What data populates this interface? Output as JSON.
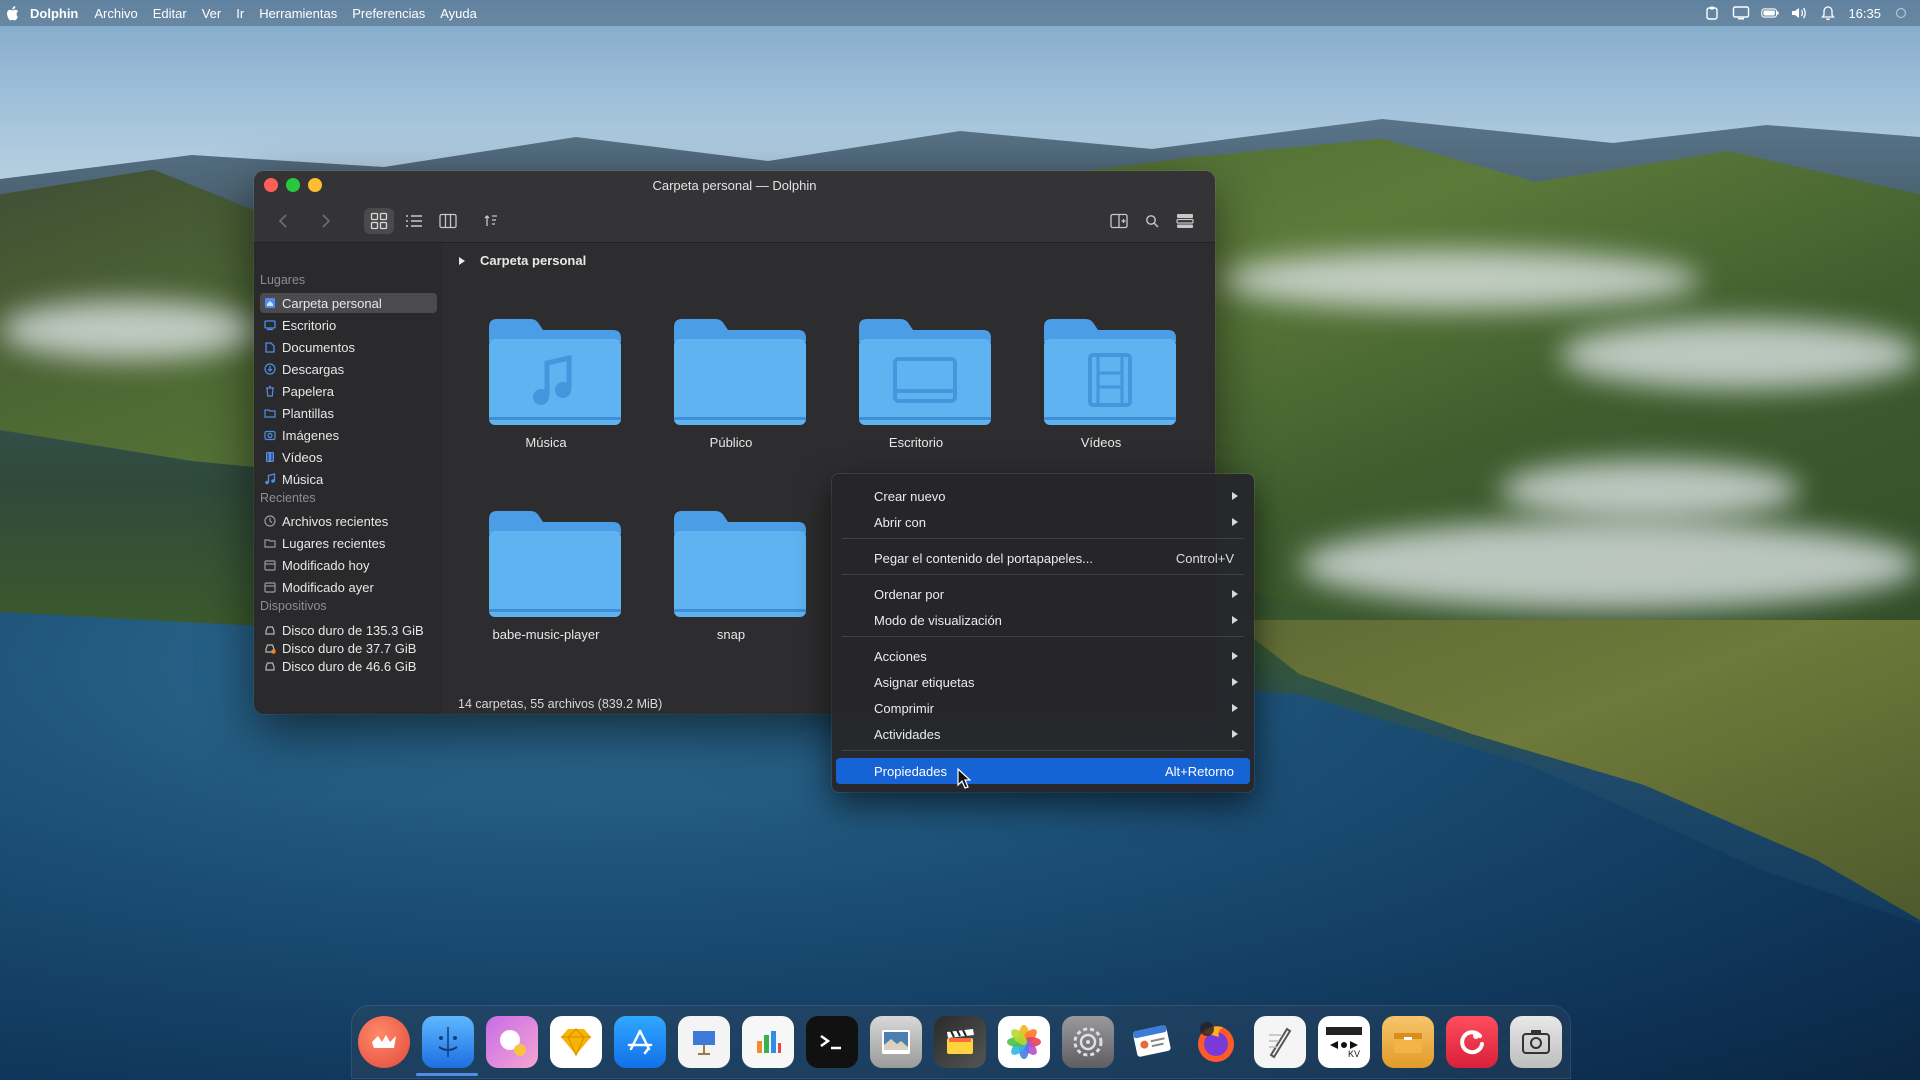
{
  "menubar": {
    "app_name": "Dolphin",
    "menus": [
      "Archivo",
      "Editar",
      "Ver",
      "Ir",
      "Herramientas",
      "Preferencias",
      "Ayuda"
    ],
    "clock": "16:35"
  },
  "window": {
    "title": "Carpeta personal — Dolphin"
  },
  "sidebar": {
    "places_title": "Lugares",
    "places": [
      {
        "label": "Carpeta personal",
        "icon": "home-icon"
      },
      {
        "label": "Escritorio",
        "icon": "desktop-icon"
      },
      {
        "label": "Documentos",
        "icon": "documents-icon"
      },
      {
        "label": "Descargas",
        "icon": "downloads-icon"
      },
      {
        "label": "Papelera",
        "icon": "trash-icon"
      },
      {
        "label": "Plantillas",
        "icon": "templates-icon"
      },
      {
        "label": "Imágenes",
        "icon": "pictures-icon"
      },
      {
        "label": "Vídeos",
        "icon": "videos-icon"
      },
      {
        "label": "Música",
        "icon": "music-icon"
      }
    ],
    "recent_title": "Recientes",
    "recent": [
      {
        "label": "Archivos recientes",
        "icon": "recent-files-icon"
      },
      {
        "label": "Lugares recientes",
        "icon": "recent-places-icon"
      },
      {
        "label": "Modificado hoy",
        "icon": "calendar-icon"
      },
      {
        "label": "Modificado ayer",
        "icon": "calendar-icon"
      }
    ],
    "devices_title": "Dispositivos",
    "devices": [
      {
        "label": "Disco duro de 135.3 GiB",
        "icon": "drive-icon"
      },
      {
        "label": "Disco duro de 37.7 GiB",
        "icon": "drive-warning-icon"
      },
      {
        "label": "Disco duro de 46.6 GiB",
        "icon": "drive-icon"
      }
    ]
  },
  "breadcrumb": "Carpeta personal",
  "folders": [
    {
      "name": "Música",
      "emblem": "music-note-icon"
    },
    {
      "name": "Público",
      "emblem": "none"
    },
    {
      "name": "Escritorio",
      "emblem": "desktop-icon"
    },
    {
      "name": "Vídeos",
      "emblem": "film-icon"
    },
    {
      "name": "babe-music-player",
      "emblem": "none"
    },
    {
      "name": "snap",
      "emblem": "none"
    }
  ],
  "status": "14 carpetas, 55 archivos (839.2 MiB)",
  "context_menu": {
    "items": [
      {
        "label": "Crear nuevo",
        "submenu": true
      },
      {
        "label": "Abrir con",
        "submenu": true
      },
      {
        "label": "Pegar el contenido del portapapeles...",
        "shortcut": "Control+V"
      },
      {
        "label": "Ordenar por",
        "submenu": true
      },
      {
        "label": "Modo de visualización",
        "submenu": true
      },
      {
        "label": "Acciones",
        "submenu": true
      },
      {
        "label": "Asignar etiquetas",
        "submenu": true
      },
      {
        "label": "Comprimir",
        "submenu": true
      },
      {
        "label": "Actividades",
        "submenu": true
      },
      {
        "label": "Propiedades",
        "shortcut": "Alt+Retorno",
        "highlighted": true
      }
    ]
  },
  "dock": {
    "apps": [
      "launchpad-icon",
      "finder-icon",
      "avatar-app-icon",
      "sketch-icon",
      "app-store-icon",
      "keynote-icon",
      "numbers-icon",
      "terminal-icon",
      "preview-icon",
      "final-cut-icon",
      "photos-icon",
      "system-preferences-icon",
      "contacts-icon",
      "firefox-icon",
      "text-editor-icon",
      "screen-capture-kv-icon",
      "archive-icon",
      "music-app-icon",
      "screenshot-icon"
    ]
  },
  "colors": {
    "accent": "#1663d6",
    "folder": "#5fb3f0",
    "window_bg": "#2d2d2f"
  }
}
